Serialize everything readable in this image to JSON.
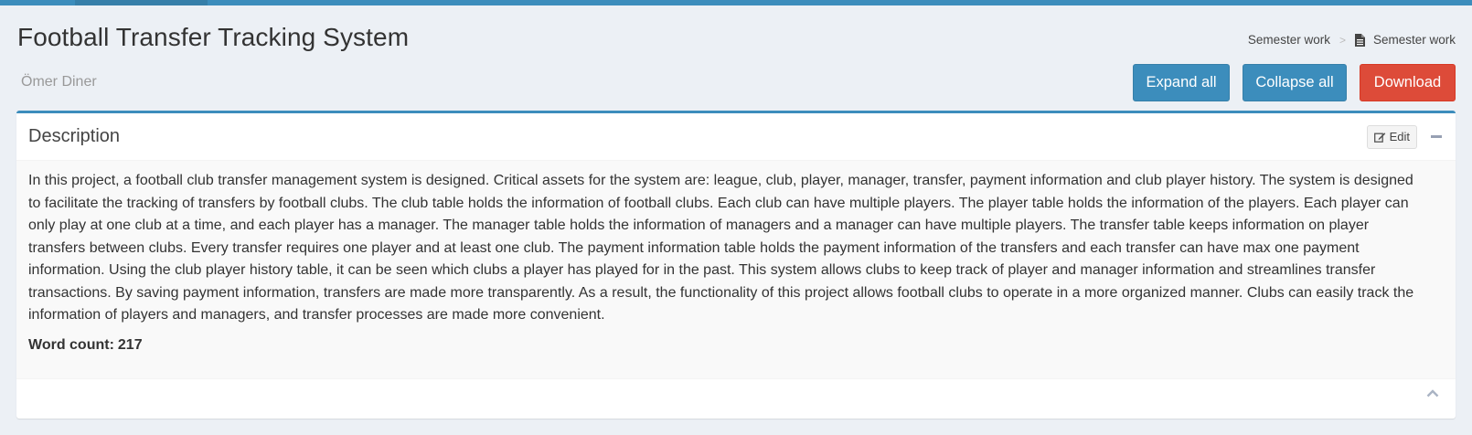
{
  "header": {
    "title": "Football Transfer Tracking System",
    "author": "Ömer Diner"
  },
  "breadcrumb": {
    "items": [
      "Semester work",
      "Semester work"
    ],
    "separator": ">"
  },
  "actions": {
    "expand_label": "Expand all",
    "collapse_label": "Collapse all",
    "download_label": "Download"
  },
  "box": {
    "title": "Description",
    "edit_label": "Edit",
    "description": "In this project, a football club transfer management system is designed. Critical assets for the system are: league, club, player, manager, transfer, payment information and club player history. The system is designed to facilitate the tracking of transfers by football clubs. The club table holds the information of football clubs. Each club can have multiple players. The player table holds the information of the players. Each player can only play at one club at a time, and each player has a manager. The manager table holds the information of managers and a manager can have multiple players. The transfer table keeps information on player transfers between clubs. Every transfer requires one player and at least one club. The payment information table holds the payment information of the transfers and each transfer can have max one payment information. Using the club player history table, it can be seen which clubs a player has played for in the past. This system allows clubs to keep track of player and manager information and streamlines transfer transactions. By saving payment information, transfers are made more transparently. As a result, the functionality of this project allows football clubs to operate in a more organized manner. Clubs can easily track the information of players and managers, and transfer processes are made more convenient.",
    "word_count_label": "Word count:",
    "word_count_value": "217"
  },
  "icons": {
    "breadcrumb_doc": "file-text-icon",
    "edit": "edit-icon",
    "minimize": "minus-icon",
    "footer": "chevron-up-icon"
  },
  "colors": {
    "primary": "#3c8dbc",
    "danger": "#dd4b39",
    "background": "#ecf0f5"
  }
}
